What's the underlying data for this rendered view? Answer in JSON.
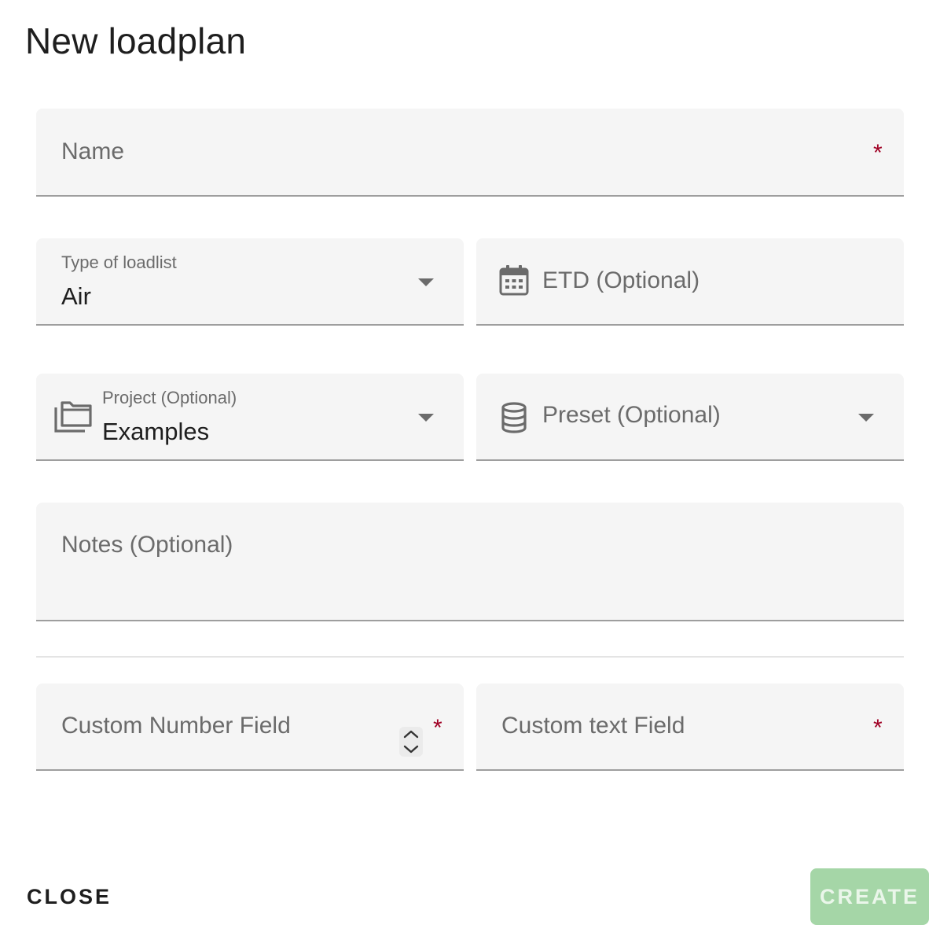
{
  "dialog": {
    "title": "New loadplan"
  },
  "fields": {
    "name": {
      "placeholder": "Name",
      "required_mark": "*"
    },
    "type_of_loadlist": {
      "label": "Type of loadlist",
      "value": "Air"
    },
    "etd": {
      "placeholder": "ETD (Optional)",
      "icon": "calendar-icon"
    },
    "project": {
      "label": "Project (Optional)",
      "value": "Examples",
      "icon": "folder-stack-icon"
    },
    "preset": {
      "placeholder": "Preset (Optional)",
      "icon": "database-icon"
    },
    "notes": {
      "placeholder": "Notes (Optional)"
    },
    "custom_number": {
      "placeholder": "Custom Number Field",
      "required_mark": "*"
    },
    "custom_text": {
      "placeholder": "Custom text Field",
      "required_mark": "*"
    }
  },
  "actions": {
    "close_label": "CLOSE",
    "create_label": "CREATE"
  },
  "colors": {
    "required": "#a00024",
    "create_disabled": "#a5d6a7",
    "field_background": "#f5f5f5"
  }
}
